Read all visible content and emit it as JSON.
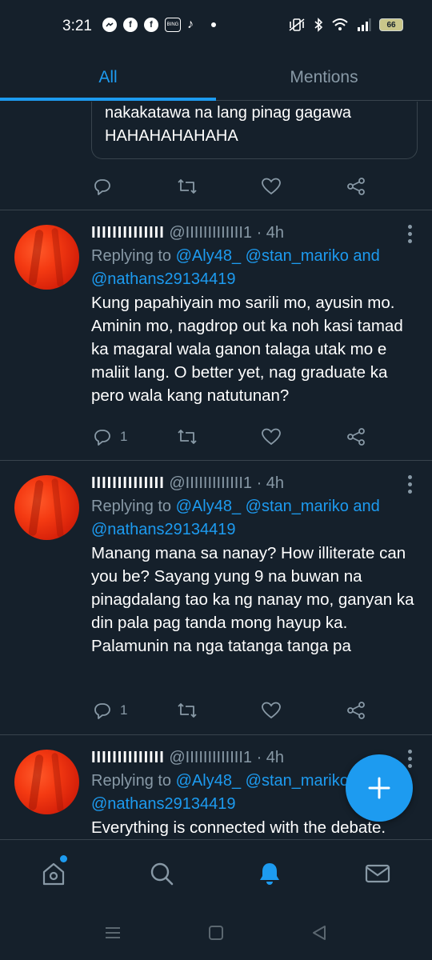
{
  "status_bar": {
    "time": "3:21",
    "notification_icons": [
      "messenger-icon",
      "facebook-icon",
      "facebook-icon",
      "bing-icon",
      "tiktok-icon"
    ],
    "battery": "66"
  },
  "tabs": [
    {
      "label": "All",
      "active": true
    },
    {
      "label": "Mentions",
      "active": false
    }
  ],
  "quoted_fragment": {
    "text": "nakakatawa na lang pinag gagawa HAHAHAHAHAHA"
  },
  "tweets": [
    {
      "name": "IIIIIIIIIIIIII",
      "handle": "@IIIIIIIIIIIII1",
      "time": "· 4h",
      "replying_prefix": "Replying to",
      "replying_to": "@Aly48_ @stan_mariko and @nathans29134419",
      "body": "Kung papahiyain mo sarili mo, ayusin mo. Aminin mo, nagdrop out ka noh kasi tamad ka magaral wala ganon talaga utak mo e maliit lang. O better yet, nag graduate ka pero wala kang natutunan?",
      "reply_count": "1"
    },
    {
      "name": "IIIIIIIIIIIIII",
      "handle": "@IIIIIIIIIIIII1",
      "time": "· 4h",
      "replying_prefix": "Replying to",
      "replying_to": "@Aly48_ @stan_mariko and @nathans29134419",
      "body": "Manang mana sa nanay? How illiterate can you be? Sayang yung 9 na buwan na pinagdalang tao ka ng nanay mo, ganyan ka din pala pag tanda mong hayup ka. Palamunin na nga tatanga tanga pa",
      "reply_count": "1"
    },
    {
      "name": "IIIIIIIIIIIIII",
      "handle": "@IIIIIIIIIIIII1",
      "time": "· 4h",
      "replying_prefix": "Replying to",
      "replying_to": "@Aly48_ @stan_mariko and @nathans29134419",
      "body": "Everything is connected with the debate.",
      "reply_count": ""
    }
  ],
  "bottom_nav": [
    "home-icon",
    "search-icon",
    "notifications-icon",
    "messages-icon"
  ],
  "colors": {
    "background": "#15202b",
    "accent": "#1d9bf0",
    "secondary_text": "#8899a6",
    "divider": "#38444d"
  }
}
